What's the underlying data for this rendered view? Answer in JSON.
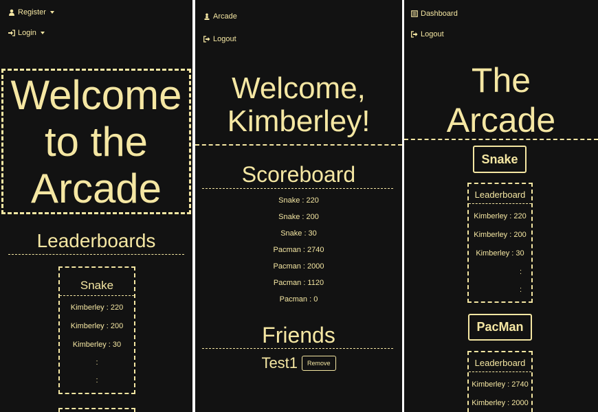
{
  "panel1": {
    "nav": {
      "register": "Register",
      "login": "Login"
    },
    "hero": {
      "line1": "Welcome",
      "line2": "to the",
      "line3": "Arcade"
    },
    "section_title": "Leaderboards",
    "snake": {
      "title": "Snake",
      "entries": [
        "Kimberley : 220",
        "Kimberley : 200",
        "Kimberley : 30",
        ":",
        ":"
      ]
    }
  },
  "panel2": {
    "nav": {
      "arcade": "Arcade",
      "logout": "Logout"
    },
    "welcome_line1": "Welcome,",
    "welcome_line2": "Kimberley!",
    "scoreboard_title": "Scoreboard",
    "scores": [
      "Snake : 220",
      "Snake : 200",
      "Snake : 30",
      "Pacman : 2740",
      "Pacman : 2000",
      "Pacman : 1120",
      "Pacman : 0"
    ],
    "friends_title": "Friends",
    "friend": {
      "name": "Test1",
      "remove_label": "Remove"
    }
  },
  "panel3": {
    "nav": {
      "dashboard": "Dashboard",
      "logout": "Logout"
    },
    "title_line1": "The",
    "title_line2": "Arcade",
    "snake_button": "Snake",
    "snake_leaderboard": {
      "title": "Leaderboard",
      "entries": [
        "Kimberley : 220",
        "Kimberley : 200",
        "Kimberley : 30",
        ":",
        ":"
      ]
    },
    "pacman_button": "PacMan",
    "pacman_leaderboard": {
      "title": "Leaderboard",
      "entries": [
        "Kimberley : 2740",
        "Kimberley : 2000"
      ]
    }
  },
  "icons": [
    "user-icon",
    "login-icon",
    "chess-pawn-icon",
    "logout-icon",
    "dashboard-icon"
  ],
  "colors": {
    "background": "#121212",
    "accent": "#f5e7a3"
  }
}
